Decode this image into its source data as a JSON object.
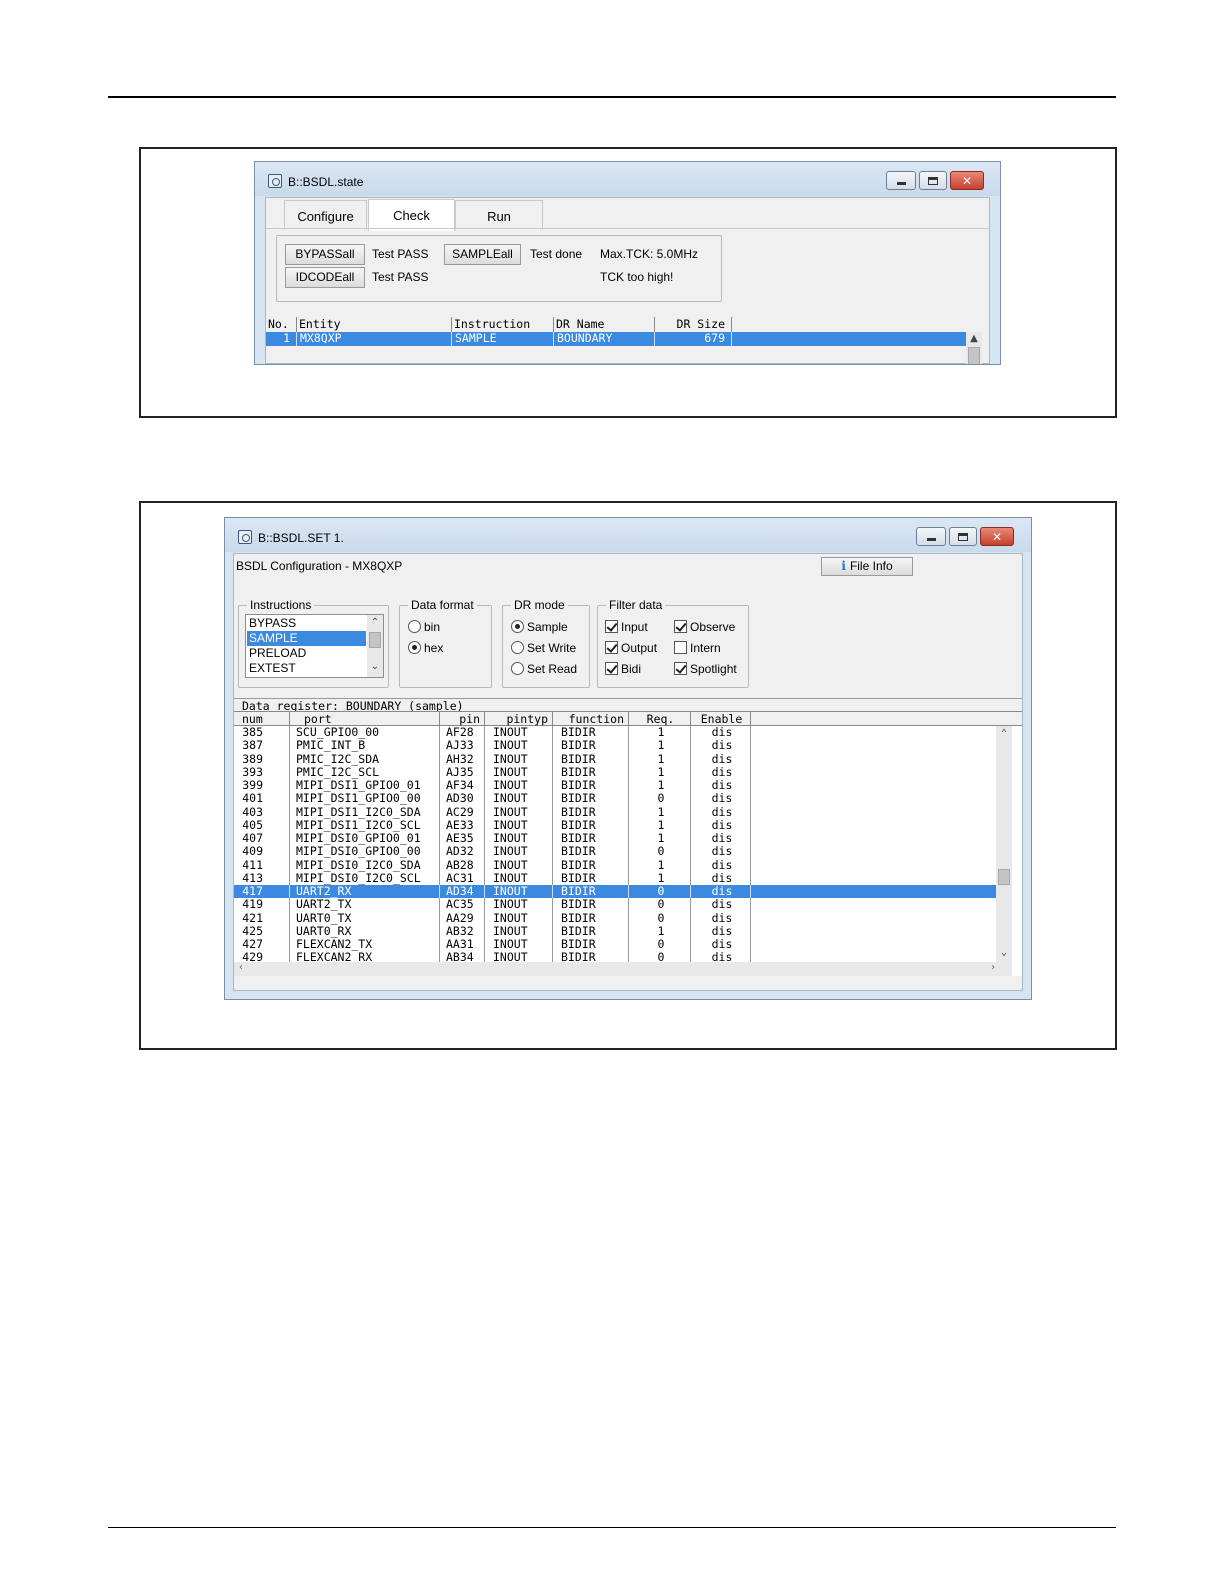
{
  "window1": {
    "title": "B::BSDL.state",
    "tabs": [
      "Configure",
      "Check",
      "Run"
    ],
    "active_tab": "Check",
    "buttons": {
      "bypassall": "BYPASSall",
      "idcodeall": "IDCODEall",
      "sampleall": "SAMPLEall"
    },
    "status": {
      "bypass_result": "Test PASS",
      "idcode_result": "Test PASS",
      "sample_result": "Test done",
      "max_tck": "Max.TCK: 5.0MHz",
      "tck_warning": "TCK too high!"
    },
    "table": {
      "headers": [
        "No.",
        "Entity",
        "Instruction",
        "DR Name",
        "DR Size"
      ],
      "rows": [
        [
          "1",
          "MX8QXP",
          "SAMPLE",
          "BOUNDARY",
          "679"
        ]
      ]
    }
  },
  "window2": {
    "title": "B::BSDL.SET 1.",
    "config_label": "BSDL Configuration -  MX8QXP",
    "file_info_button": "File Info",
    "instructions": {
      "legend": "Instructions",
      "items": [
        "BYPASS",
        "SAMPLE",
        "PRELOAD",
        "EXTEST"
      ],
      "selected": "SAMPLE"
    },
    "data_format": {
      "legend": "Data format",
      "options": [
        "bin",
        "hex"
      ],
      "selected": "hex"
    },
    "dr_mode": {
      "legend": "DR mode",
      "options": [
        "Sample",
        "Set Write",
        "Set Read"
      ],
      "selected": "Sample"
    },
    "filter_data": {
      "legend": "Filter data",
      "options": [
        {
          "label": "Input",
          "checked": true
        },
        {
          "label": "Observe",
          "checked": true
        },
        {
          "label": "Output",
          "checked": true
        },
        {
          "label": "Intern",
          "checked": false
        },
        {
          "label": "Bidi",
          "checked": true
        },
        {
          "label": "Spotlight",
          "checked": true
        }
      ]
    },
    "grid": {
      "caption": "Data register: BOUNDARY (sample)",
      "headers": [
        "num",
        "port",
        "pin",
        "pintyp",
        "function",
        "Req.",
        "Enable"
      ],
      "selected_index": 12,
      "rows": [
        [
          "385",
          "SCU_GPIO0_00",
          "AF28",
          "INOUT",
          "BIDIR",
          "1",
          "dis"
        ],
        [
          "387",
          "PMIC_INT_B",
          "AJ33",
          "INOUT",
          "BIDIR",
          "1",
          "dis"
        ],
        [
          "389",
          "PMIC_I2C_SDA",
          "AH32",
          "INOUT",
          "BIDIR",
          "1",
          "dis"
        ],
        [
          "393",
          "PMIC_I2C_SCL",
          "AJ35",
          "INOUT",
          "BIDIR",
          "1",
          "dis"
        ],
        [
          "399",
          "MIPI_DSI1_GPIO0_01",
          "AF34",
          "INOUT",
          "BIDIR",
          "1",
          "dis"
        ],
        [
          "401",
          "MIPI_DSI1_GPIO0_00",
          "AD30",
          "INOUT",
          "BIDIR",
          "0",
          "dis"
        ],
        [
          "403",
          "MIPI_DSI1_I2C0_SDA",
          "AC29",
          "INOUT",
          "BIDIR",
          "1",
          "dis"
        ],
        [
          "405",
          "MIPI_DSI1_I2C0_SCL",
          "AE33",
          "INOUT",
          "BIDIR",
          "1",
          "dis"
        ],
        [
          "407",
          "MIPI_DSI0_GPIO0_01",
          "AE35",
          "INOUT",
          "BIDIR",
          "1",
          "dis"
        ],
        [
          "409",
          "MIPI_DSI0_GPIO0_00",
          "AD32",
          "INOUT",
          "BIDIR",
          "0",
          "dis"
        ],
        [
          "411",
          "MIPI_DSI0_I2C0_SDA",
          "AB28",
          "INOUT",
          "BIDIR",
          "1",
          "dis"
        ],
        [
          "413",
          "MIPI_DSI0_I2C0_SCL",
          "AC31",
          "INOUT",
          "BIDIR",
          "1",
          "dis"
        ],
        [
          "417",
          "UART2_RX",
          "AD34",
          "INOUT",
          "BIDIR",
          "0",
          "dis"
        ],
        [
          "419",
          "UART2_TX",
          "AC35",
          "INOUT",
          "BIDIR",
          "0",
          "dis"
        ],
        [
          "421",
          "UART0_TX",
          "AA29",
          "INOUT",
          "BIDIR",
          "0",
          "dis"
        ],
        [
          "425",
          "UART0_RX",
          "AB32",
          "INOUT",
          "BIDIR",
          "1",
          "dis"
        ],
        [
          "427",
          "FLEXCAN2_TX",
          "AA31",
          "INOUT",
          "BIDIR",
          "0",
          "dis"
        ],
        [
          "429",
          "FLEXCAN2_RX",
          "AB34",
          "INOUT",
          "BIDIR",
          "0",
          "dis"
        ]
      ]
    }
  }
}
